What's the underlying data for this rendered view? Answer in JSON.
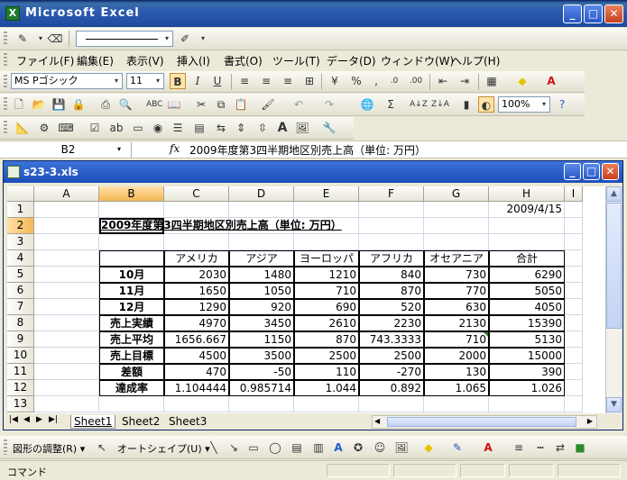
{
  "app": {
    "title": "Microsoft Excel"
  },
  "menu": [
    "ファイル(F)",
    "編集(E)",
    "表示(V)",
    "挿入(I)",
    "書式(O)",
    "ツール(T)",
    "データ(D)",
    "ウィンドウ(W)",
    "ヘルプ(H)"
  ],
  "format_toolbar": {
    "font_name": "MS Pゴシック",
    "font_size": "11",
    "bold": "B",
    "italic": "I",
    "underline": "U"
  },
  "std_toolbar": {
    "zoom": "100%"
  },
  "formula_bar": {
    "name_box": "B2",
    "fx": "fx",
    "content": "2009年度第3四半期地区別売上高（単位: 万円）"
  },
  "workbook": {
    "title": "s23-3.xls",
    "columns": [
      "A",
      "B",
      "C",
      "D",
      "E",
      "F",
      "G",
      "H",
      "I"
    ],
    "rows": [
      "1",
      "2",
      "3",
      "4",
      "5",
      "6",
      "7",
      "8",
      "9",
      "10",
      "11",
      "12",
      "13"
    ],
    "date": "2009/4/15",
    "heading": "2009年度第3四半期地区別売上高（単位: 万円）",
    "table": {
      "headers": [
        "アメリカ",
        "アジア",
        "ヨーロッパ",
        "アフリカ",
        "オセアニア",
        "合計"
      ],
      "rows": [
        {
          "label": "10月",
          "values": [
            "2030",
            "1480",
            "1210",
            "840",
            "730",
            "6290"
          ]
        },
        {
          "label": "11月",
          "values": [
            "1650",
            "1050",
            "710",
            "870",
            "770",
            "5050"
          ]
        },
        {
          "label": "12月",
          "values": [
            "1290",
            "920",
            "690",
            "520",
            "630",
            "4050"
          ]
        },
        {
          "label": "売上実績",
          "values": [
            "4970",
            "3450",
            "2610",
            "2230",
            "2130",
            "15390"
          ]
        },
        {
          "label": "売上平均",
          "values": [
            "1656.667",
            "1150",
            "870",
            "743.3333",
            "710",
            "5130"
          ]
        },
        {
          "label": "売上目標",
          "values": [
            "4500",
            "3500",
            "2500",
            "2500",
            "2000",
            "15000"
          ]
        },
        {
          "label": "差額",
          "values": [
            "470",
            "-50",
            "110",
            "-270",
            "130",
            "390"
          ]
        },
        {
          "label": "達成率",
          "values": [
            "1.104444",
            "0.985714",
            "1.044",
            "0.892",
            "1.065",
            "1.026"
          ]
        }
      ]
    },
    "sheets": [
      "Sheet1",
      "Sheet2",
      "Sheet3"
    ]
  },
  "draw_toolbar": {
    "adjust": "図形の調整(R) ▾",
    "autoshape": "オートシェイプ(U) ▾"
  },
  "status": {
    "text": "コマンド"
  }
}
